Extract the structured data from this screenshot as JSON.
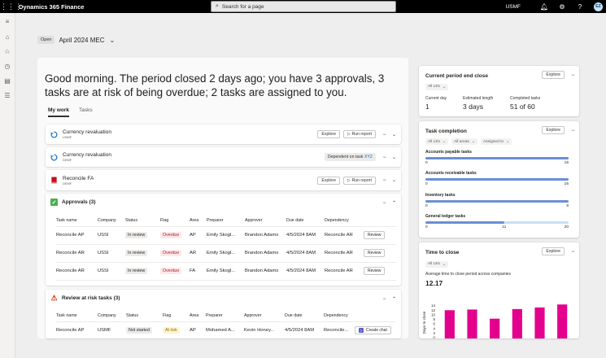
{
  "topbar": {
    "app_title": "Dynamics 365 Finance",
    "search_placeholder": "Search for a page",
    "company": "USMF",
    "user_initials": "EZ"
  },
  "period": {
    "status": "Open",
    "name": "April 2024 MEC"
  },
  "greeting": "Good morning. The period closed 2 days ago; you have 3 approvals, 3 tasks are at risk of being overdue; 2 tasks are assigned to you.",
  "tabs": [
    {
      "label": "My work",
      "active": true
    },
    {
      "label": "Tasks",
      "active": false
    }
  ],
  "tasks": [
    {
      "name": "Currency revaluation",
      "company": "USMF",
      "icon": "sync-icon",
      "explore": "Explore",
      "action": "Run report"
    },
    {
      "name": "Currency revaluation",
      "company": "DEMF",
      "icon": "sync-icon",
      "dependency_prefix": "Dependent on task",
      "dependency_link": "XYZ"
    },
    {
      "name": "Reconcile FA",
      "company": "DEMF",
      "icon": "book-icon",
      "explore": "Explore",
      "action": "Run report"
    }
  ],
  "approvals": {
    "title": "Approvals (3)",
    "columns": [
      "Task name",
      "Company",
      "Status",
      "Flag",
      "Area",
      "Preparer",
      "Approver",
      "Due date",
      "Dependency",
      ""
    ],
    "rows": [
      {
        "task": "Reconcile AP",
        "company": "USSI",
        "status": "In review",
        "flag": "Overdue",
        "area": "AP",
        "preparer": "Emily Skogl...",
        "approver": "Brandon Adams",
        "due": "4/5/2024 8AM",
        "dependency": "Reconcile AR",
        "action": "Review"
      },
      {
        "task": "Reconcile AR",
        "company": "USSI",
        "status": "In review",
        "flag": "Overdue",
        "area": "AR",
        "preparer": "Emily Skogl...",
        "approver": "Brandon Adams",
        "due": "4/5/2024 8AM",
        "dependency": "Reconcile AR",
        "action": "Review"
      },
      {
        "task": "Reconcile AR",
        "company": "USSI",
        "status": "In review",
        "flag": "Overdue",
        "area": "FA",
        "preparer": "Emily Skogl...",
        "approver": "Brandon Adams",
        "due": "4/5/2024 8AM",
        "dependency": "Reconcile AR",
        "action": "Review"
      }
    ]
  },
  "at_risk": {
    "title": "Review at risk tasks (3)",
    "columns": [
      "Task name",
      "Company",
      "Status",
      "Flag",
      "Area",
      "Preparer",
      "Approver",
      "Due date",
      "Dependency",
      ""
    ],
    "rows": [
      {
        "task": "Reconcile AP",
        "company": "USMF",
        "status": "Not started",
        "flag": "At risk",
        "area": "AP",
        "preparer": "Mohamed A...",
        "approver": "Kevin Honey...",
        "due": "4/5/2024 8AM",
        "dependency": "Reconcile...",
        "action": "Create chat"
      }
    ]
  },
  "current_period": {
    "title": "Current period end close",
    "explore": "Explore",
    "filter": "All LEs",
    "stats": [
      {
        "label": "Current day",
        "value": "1"
      },
      {
        "label": "Estimated length",
        "value": "3 days"
      },
      {
        "label": "Completed tasks",
        "value": "51 of 60"
      }
    ]
  },
  "task_completion": {
    "title": "Task completion",
    "explore": "Explore",
    "filters": [
      "All LEs",
      "All areas",
      "Assigned to"
    ],
    "bars": [
      {
        "label": "Accounts payable tasks",
        "min": "0",
        "max": "16",
        "done": 16,
        "total": 16,
        "tick": ""
      },
      {
        "label": "Accounts receivable tasks",
        "min": "0",
        "max": "16",
        "done": 16,
        "total": 16,
        "tick": ""
      },
      {
        "label": "Inventory tasks",
        "min": "0",
        "max": "8",
        "done": 8,
        "total": 8,
        "tick": ""
      },
      {
        "label": "General ledger tasks",
        "min": "0",
        "max": "20",
        "done": 11,
        "total": 20,
        "tick": "11"
      }
    ]
  },
  "time_to_close": {
    "title": "Time to close",
    "explore": "Explore",
    "filter": "All LEs",
    "subtitle": "Average time to close period across companies",
    "average": "12.17"
  },
  "chart_data": {
    "type": "bar",
    "title": "",
    "xlabel": "",
    "ylabel": "Days to close",
    "ylim": [
      0,
      16
    ],
    "yticks": [
      0,
      2,
      4,
      6,
      8,
      10,
      12,
      14
    ],
    "categories": [
      "",
      "",
      "",
      "",
      "",
      ""
    ],
    "values": [
      12,
      12.3,
      8.3,
      12.5,
      13.2,
      14.5
    ],
    "color": "#e3008c"
  },
  "colors": {
    "accent": "#0f6cbd",
    "bar_fill": "#6b8ed6",
    "bar_track": "#c7e0f4",
    "overdue_bg": "#fde7e9",
    "at_risk_bg": "#fff4ce",
    "magenta": "#e3008c"
  }
}
